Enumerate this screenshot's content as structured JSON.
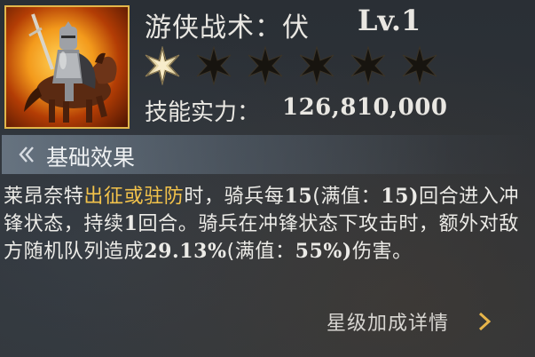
{
  "skill": {
    "title": "游侠战术：伏",
    "level": "Lv.1",
    "stars_total": 6,
    "stars_filled": 1,
    "power_label": "技能实力：",
    "power_value": "126,810,000",
    "portrait_icon": "mounted-knight-icon"
  },
  "section": {
    "icon": "double-chevron-icon",
    "title": "基础效果"
  },
  "description": {
    "p1": "莱昂奈特",
    "p2": "出征或驻防",
    "p3": "时，骑兵每",
    "p4": "15",
    "p5": "(满值：",
    "p6": "15)",
    "p7": "回合进入冲锋状态，持续",
    "p8": "1",
    "p9": "回合。骑兵在冲锋状态下攻击时，额外对敌方随机队列造成",
    "p10": "29.13%",
    "p11": "(满值：",
    "p12": "55%)",
    "p13": "伤害。"
  },
  "footer": {
    "link_label": "星级加成详情",
    "link_icon": "chevron-right-icon"
  },
  "colors": {
    "highlight": "#f3c34b",
    "text": "#ecebe7",
    "star_filled": "#e6d6a6",
    "star_empty": "#17140f"
  }
}
